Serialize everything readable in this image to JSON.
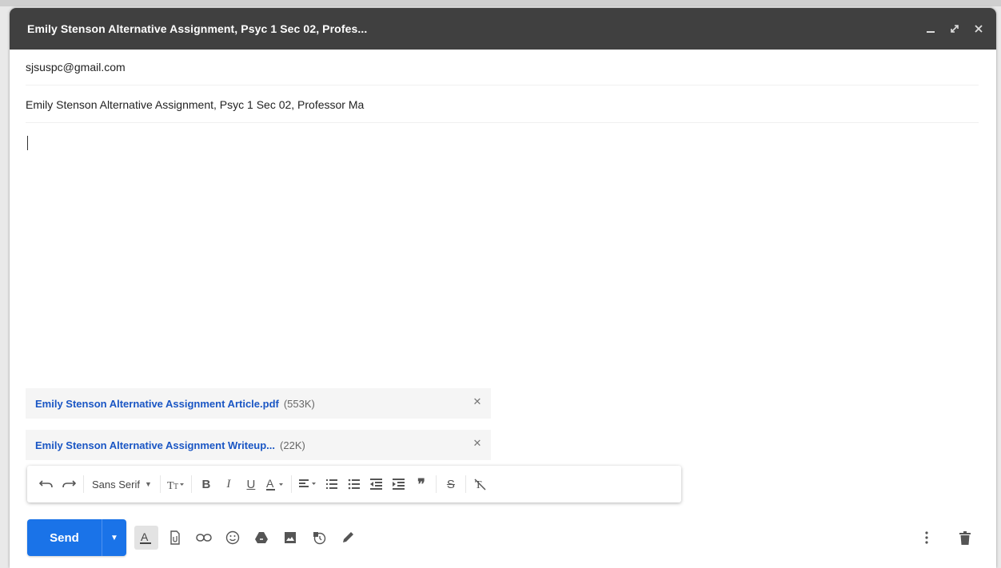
{
  "header": {
    "title": "Emily Stenson Alternative Assignment, Psyc 1 Sec 02, Profes...",
    "controls": [
      "minimize-icon",
      "fullscreen-icon",
      "close-icon"
    ]
  },
  "fields": {
    "to": "sjsuspc@gmail.com",
    "subject": "Emily Stenson Alternative Assignment, Psyc 1 Sec 02, Professor Ma"
  },
  "attachments": [
    {
      "name": "Emily Stenson Alternative Assignment Article.pdf",
      "size": "(553K)"
    },
    {
      "name": "Emily Stenson Alternative Assignment Writeup...",
      "size": "(22K)"
    }
  ],
  "toolbar": {
    "font_name": "Sans Serif",
    "icons": [
      "undo-icon",
      "redo-icon",
      "font-size-icon",
      "bold-icon",
      "italic-icon",
      "underline-icon",
      "text-color-icon",
      "align-icon",
      "numbered-list-icon",
      "bulleted-list-icon",
      "indent-less-icon",
      "indent-more-icon",
      "quote-icon",
      "strikethrough-icon",
      "remove-formatting-icon"
    ]
  },
  "bottom": {
    "send_label": "Send",
    "icons": [
      "formatting-options-icon",
      "attach-file-icon",
      "insert-link-icon",
      "insert-emoji-icon",
      "google-drive-icon",
      "insert-photo-icon",
      "confidential-mode-icon",
      "signature-icon",
      "more-options-icon",
      "discard-draft-icon"
    ]
  },
  "colors": {
    "header_bg": "#404040",
    "send_blue": "#1a73e8",
    "attachment_link": "#1a56c4"
  }
}
